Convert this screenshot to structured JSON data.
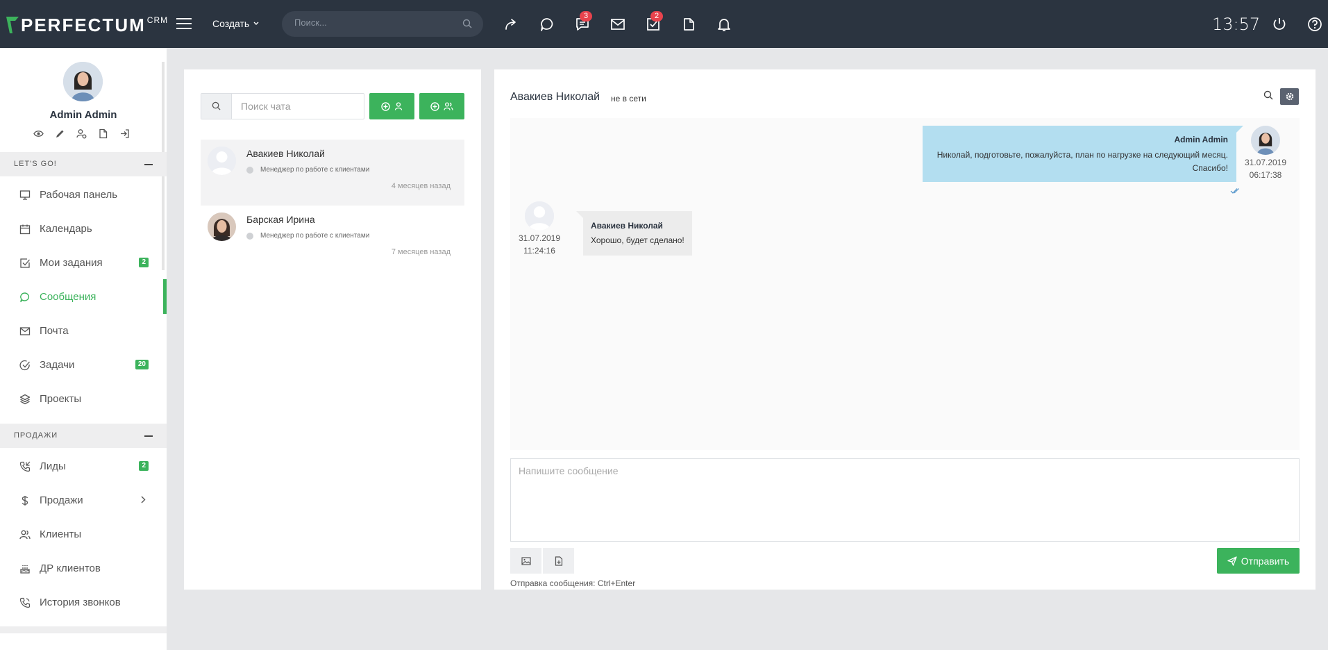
{
  "app": {
    "logo_text": "PERFECTUM",
    "logo_sup": "CRM",
    "create_label": "Создать",
    "search_placeholder": "Поиск...",
    "clock": "13:57",
    "badges": {
      "chats": "3",
      "tasks": "2"
    },
    "accent": "#3cb35c",
    "topbar_color": "#2b3440",
    "badge_color": "#e8434d"
  },
  "profile": {
    "name": "Admin Admin",
    "icons": [
      "eye-icon",
      "pencil-icon",
      "user-settings-icon",
      "file-icon",
      "logout-icon"
    ]
  },
  "sidebar": {
    "section1": "LET'S GO!",
    "section2": "ПРОДАЖИ",
    "items": [
      {
        "label": "Рабочая панель",
        "icon": "monitor-icon"
      },
      {
        "label": "Календарь",
        "icon": "calendar-icon"
      },
      {
        "label": "Мои задания",
        "icon": "checkbox-icon",
        "badge": "2"
      },
      {
        "label": "Сообщения",
        "icon": "message-icon",
        "active": true
      },
      {
        "label": "Почта",
        "icon": "mail-icon"
      },
      {
        "label": "Задачи",
        "icon": "check-circle-icon",
        "badge": "20"
      },
      {
        "label": "Проекты",
        "icon": "layers-icon"
      },
      {
        "label": "Лиды",
        "icon": "phone-in-icon",
        "badge": "2"
      },
      {
        "label": "Продажи",
        "icon": "dollar-icon"
      },
      {
        "label": "Клиенты",
        "icon": "users-icon"
      },
      {
        "label": "ДР клиентов",
        "icon": "cake-icon"
      },
      {
        "label": "История звонков",
        "icon": "phone-icon"
      }
    ]
  },
  "chat_list": {
    "search_placeholder": "Поиск чата",
    "contacts": [
      {
        "name": "Авакиев Николай",
        "role": "Менеджер по работе с клиентами",
        "time": "4 месяцев назад"
      },
      {
        "name": "Барская Ирина",
        "role": "Менеджер по работе с клиентами",
        "time": "7 месяцев назад"
      }
    ]
  },
  "conversation": {
    "title": "Авакиев Николай",
    "status": "не в сети",
    "messages": [
      {
        "author": "Admin Admin",
        "text": "Николай, подготовьте, пожалуйста, план по нагрузке на следующий месяц. Спасибо!",
        "date": "31.07.2019",
        "time": "06:17:38"
      },
      {
        "author": "Авакиев Николай",
        "text": "Хорошо, будет сделано!",
        "date": "31.07.2019",
        "time": "11:24:16"
      }
    ],
    "compose_placeholder": "Напишите сообщение",
    "send_label": "Отправить",
    "hint": "Отправка сообщения: Ctrl+Enter"
  }
}
